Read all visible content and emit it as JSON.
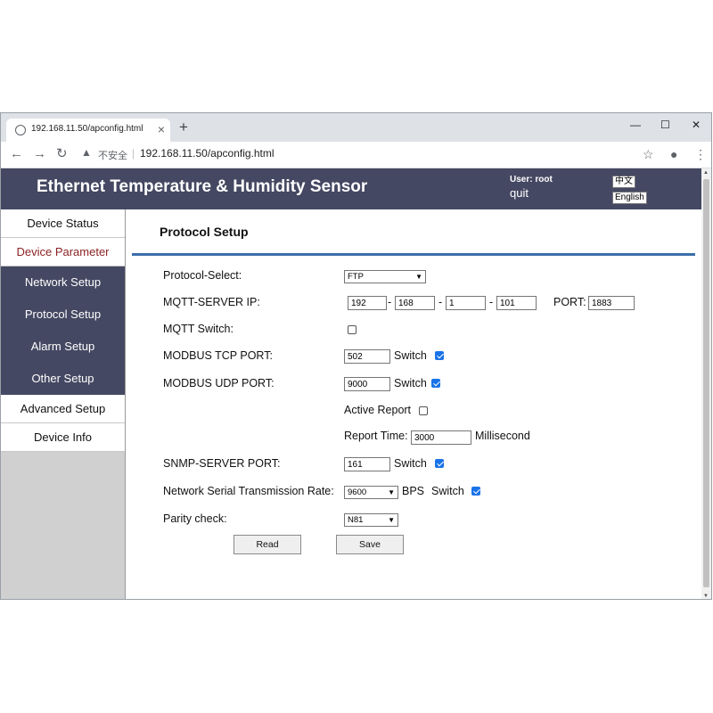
{
  "browser": {
    "tab_title": "192.168.11.50/apconfig.html",
    "tab_close": "×",
    "new_tab": "+",
    "minimize": "—",
    "maximize": "☐",
    "close": "✕",
    "back": "←",
    "forward": "→",
    "reload": "↻",
    "warning_icon": "▲",
    "insecure_label": "不安全",
    "separator": "|",
    "url": "192.168.11.50/apconfig.html",
    "star": "☆",
    "profile": "●",
    "menu": "⋮"
  },
  "header": {
    "title": "Ethernet Temperature & Humidity Sensor",
    "user_label": "User: root",
    "quit": "quit",
    "lang_zh": "中文",
    "lang_en": "English",
    "bg_color": "#454862"
  },
  "sidebar": {
    "items": [
      {
        "label": "Device Status"
      },
      {
        "label": "Device Parameter"
      },
      {
        "label": "Network Setup"
      },
      {
        "label": "Protocol Setup"
      },
      {
        "label": "Alarm Setup"
      },
      {
        "label": "Other Setup"
      },
      {
        "label": "Advanced Setup"
      },
      {
        "label": "Device Info"
      }
    ]
  },
  "main": {
    "title": "Protocol Setup",
    "protocol_select_label": "Protocol-Select:",
    "protocol_value": "FTP",
    "mqtt_server_ip_label": "MQTT-SERVER IP:",
    "ip": [
      "192",
      "168",
      "1",
      "101"
    ],
    "ip_sep": "-",
    "port_label": "PORT:",
    "mqtt_port": "1883",
    "mqtt_switch_label": "MQTT Switch:",
    "mqtt_switch_checked": false,
    "modbus_tcp_label": "MODBUS TCP PORT:",
    "modbus_tcp_port": "502",
    "modbus_tcp_switch_checked": true,
    "modbus_udp_label": "MODBUS UDP PORT:",
    "modbus_udp_port": "9000",
    "modbus_udp_switch_checked": true,
    "switch_label": "Switch",
    "active_report_label": "Active Report",
    "active_report_checked": false,
    "report_time_label": "Report Time:",
    "report_time": "3000",
    "millisecond": "Millisecond",
    "snmp_label": "SNMP-SERVER PORT:",
    "snmp_port": "161",
    "snmp_switch_checked": true,
    "serial_rate_label": "Network Serial Transmission Rate:",
    "serial_rate": "9600",
    "bps": "BPS",
    "serial_switch_checked": true,
    "parity_label": "Parity check:",
    "parity_value": "N81",
    "read_button": "Read",
    "save_button": "Save",
    "accent_color": "#3a6ea8",
    "check_color": "#1a73e8"
  }
}
